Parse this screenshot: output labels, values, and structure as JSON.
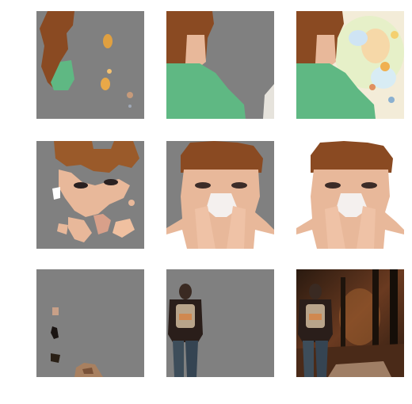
{
  "figure": {
    "rows": [
      {
        "subject": "person-in-green-shirt-over-painting",
        "tiles": [
          {
            "variant": "sparse-mask",
            "background": "#808080"
          },
          {
            "variant": "foreground-mask",
            "background": "#808080"
          },
          {
            "variant": "original",
            "background": "#f3ecd8"
          }
        ]
      },
      {
        "subject": "woman-with-tissue",
        "tiles": [
          {
            "variant": "sparse-mask",
            "background": "#808080"
          },
          {
            "variant": "foreground-mask",
            "background": "#808080"
          },
          {
            "variant": "original",
            "background": "#ffffff"
          }
        ]
      },
      {
        "subject": "hiker-in-forest",
        "tiles": [
          {
            "variant": "sparse-mask",
            "background": "#808080"
          },
          {
            "variant": "foreground-mask",
            "background": "#808080"
          },
          {
            "variant": "original",
            "background": "#3a2416"
          }
        ]
      }
    ],
    "colors": {
      "mask_gray": "#808080",
      "hair": "#8a4a22",
      "skin": "#e8b89a",
      "shirt": "#5fb883",
      "tissue": "#f4f0ee",
      "forest": "#3a2416",
      "jacket": "#2a1e1a",
      "jeans": "#3d4d5a"
    }
  }
}
